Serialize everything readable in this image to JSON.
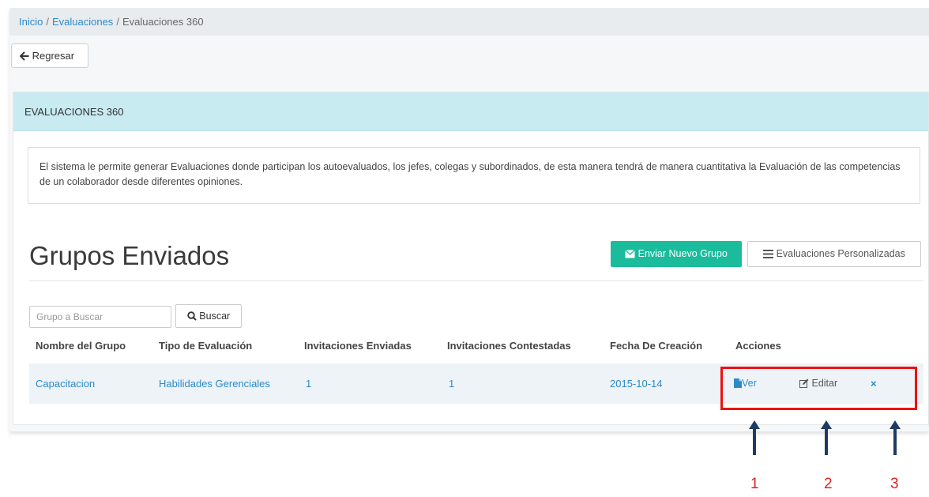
{
  "breadcrumb": {
    "home": "Inicio",
    "evaluaciones": "Evaluaciones",
    "current": "Evaluaciones 360",
    "separator": "/"
  },
  "back_button": {
    "label": "Regresar",
    "icon": "arrow-left-icon"
  },
  "panel": {
    "header": "EVALUACIONES 360",
    "info": "El sistema le permite generar Evaluaciones donde participan los autoevaluados, los jefes, colegas y subordinados, de esta manera tendrá de manera cuantitativa la Evaluación de las competencias de un colaborador desde diferentes opiniones."
  },
  "groups": {
    "title": "Grupos Enviados",
    "send_button": "Enviar Nuevo Grupo",
    "custom_button": "Evaluaciones Personalizadas",
    "search_placeholder": "Grupo a Buscar",
    "search_value": "",
    "search_button": "Buscar",
    "columns": [
      "Nombre del Grupo",
      "Tipo de Evaluación",
      "Invitaciones Enviadas",
      "Invitaciones Contestadas",
      "Fecha De Creación",
      "Acciones"
    ],
    "rows": [
      {
        "name": "Capacitacion",
        "type": "Habilidades Gerenciales",
        "sent": "1",
        "answered": "1",
        "date": "2015-10-14",
        "actions": {
          "view": "Ver",
          "edit": "Editar",
          "delete": "×"
        }
      }
    ]
  },
  "annotations": {
    "labels": [
      "1",
      "2",
      "3"
    ],
    "color": "#e02020",
    "arrow_color": "#1f3b63"
  },
  "colors": {
    "accent": "#1abc9c",
    "link": "#2c8aca",
    "panel_header": "#c7ebf0",
    "row_bg": "#edf3f7"
  }
}
